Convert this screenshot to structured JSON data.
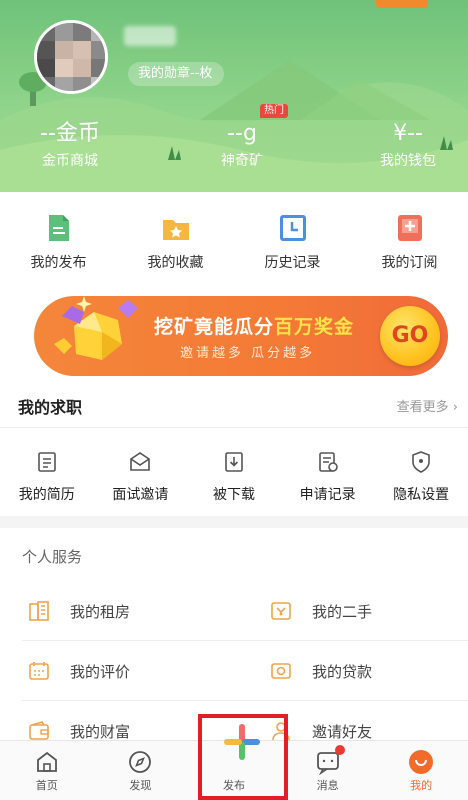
{
  "header": {
    "corner_tag": "",
    "medal_text": "我的勋章--枚",
    "stats": [
      {
        "value": "--金币",
        "label": "金币商城"
      },
      {
        "value": "--g",
        "label": "神奇矿",
        "badge": "热门"
      },
      {
        "value": "¥--",
        "label": "我的钱包"
      }
    ]
  },
  "quick_actions": [
    {
      "label": "我的发布",
      "icon": "document-icon"
    },
    {
      "label": "我的收藏",
      "icon": "folder-star-icon"
    },
    {
      "label": "历史记录",
      "icon": "clock-icon"
    },
    {
      "label": "我的订阅",
      "icon": "subscribe-icon"
    }
  ],
  "banner": {
    "title_main": "挖矿竟能瓜分",
    "title_highlight": "百万奖金",
    "subtitle": "邀请越多 瓜分越多",
    "button": "GO"
  },
  "job": {
    "title": "我的求职",
    "more": "查看更多 ›",
    "items": [
      {
        "label": "我的简历",
        "icon": "resume-icon"
      },
      {
        "label": "面试邀请",
        "icon": "mail-icon"
      },
      {
        "label": "被下载",
        "icon": "download-icon"
      },
      {
        "label": "申请记录",
        "icon": "record-icon"
      },
      {
        "label": "隐私设置",
        "icon": "shield-icon"
      }
    ]
  },
  "services": {
    "title": "个人服务",
    "items": [
      {
        "label": "我的租房",
        "icon": "building-icon"
      },
      {
        "label": "我的二手",
        "icon": "secondhand-icon"
      },
      {
        "label": "我的评价",
        "icon": "rating-icon"
      },
      {
        "label": "我的贷款",
        "icon": "loan-icon"
      },
      {
        "label": "我的财富",
        "icon": "wallet-icon"
      },
      {
        "label": "邀请好友",
        "icon": "invite-icon"
      }
    ]
  },
  "bottom_nav": [
    {
      "label": "首页",
      "icon": "home-icon"
    },
    {
      "label": "发现",
      "icon": "compass-icon"
    },
    {
      "label": "发布",
      "icon": "plus-icon"
    },
    {
      "label": "消息",
      "icon": "message-icon"
    },
    {
      "label": "我的",
      "icon": "profile-icon"
    }
  ],
  "colors": {
    "header_green": "#7ccb82",
    "accent_orange": "#f26b2b",
    "highlight_red": "#e21f26"
  }
}
